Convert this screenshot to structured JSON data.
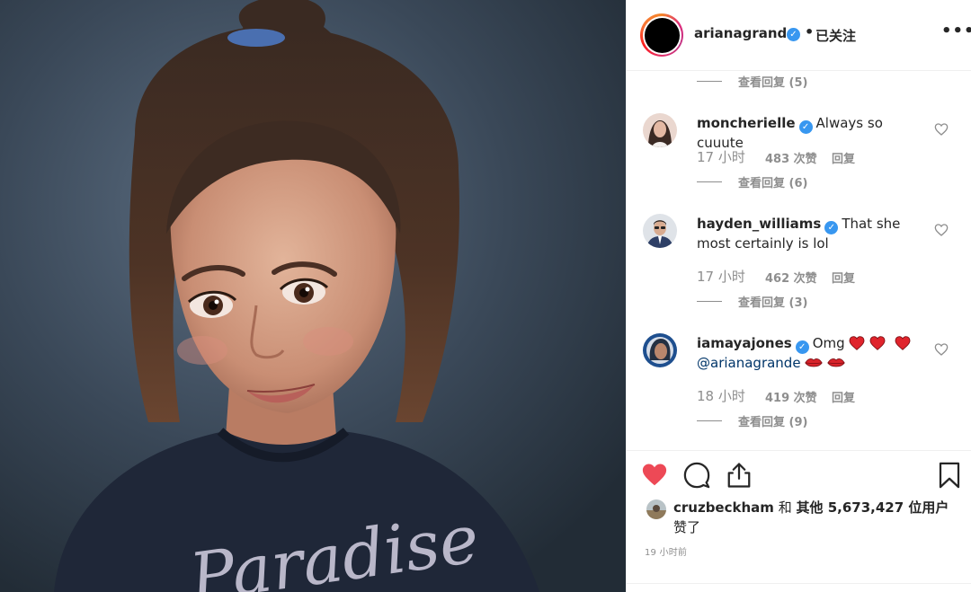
{
  "header": {
    "username": "arianagrande",
    "follow_status": "已关注",
    "separator": "•",
    "more": "•••"
  },
  "comments": [
    {
      "username": "moncherielle",
      "verified": true,
      "text": "Always so cuuute",
      "time": "17 小时",
      "likes": "483 次赞",
      "reply": "回复",
      "view_replies": "查看回复 (6)"
    },
    {
      "username": "hayden_williams",
      "verified": true,
      "text": "That she most certainly is lol",
      "time": "17 小时",
      "likes": "462 次赞",
      "reply": "回复",
      "view_replies": "查看回复 (3)"
    },
    {
      "username": "iamayajones",
      "verified": true,
      "text_prefix": "Omg",
      "mention": "@arianagrande",
      "time": "18 小时",
      "likes": "419 次赞",
      "reply": "回复",
      "view_replies": "查看回复 (9)"
    }
  ],
  "top_view_replies": "查看回复 (5)",
  "liked_by": {
    "user": "cruzbeckham",
    "connector": "和",
    "others": "其他 5,673,427 位用户",
    "suffix": "赞了"
  },
  "timestamp": "19 小时前",
  "photo": {
    "shirt_text": "Paradise"
  },
  "colors": {
    "like_red": "#ed4956",
    "verified_blue": "#3897f0",
    "muted_gray": "#8e8e8e",
    "text_dark": "#262626"
  },
  "icons": {
    "like": "heart-filled-icon",
    "comment": "speech-bubble-icon",
    "share": "share-icon",
    "save": "bookmark-icon",
    "comment_like": "heart-outline-icon",
    "more": "more-dots-icon"
  }
}
